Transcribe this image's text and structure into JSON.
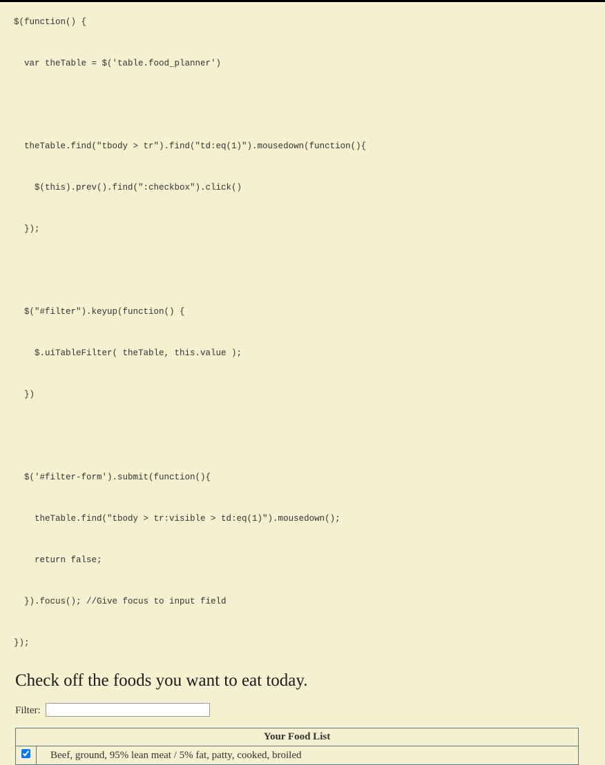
{
  "code": "$(function() {\n\n  var theTable = $('table.food_planner')\n\n\n\n  theTable.find(\"tbody > tr\").find(\"td:eq(1)\").mousedown(function(){\n\n    $(this).prev().find(\":checkbox\").click()\n\n  });\n\n\n\n  $(\"#filter\").keyup(function() {\n\n    $.uiTableFilter( theTable, this.value );\n\n  })\n\n\n\n  $('#filter-form').submit(function(){\n\n    theTable.find(\"tbody > tr:visible > td:eq(1)\").mousedown();\n\n    return false;\n\n  }).focus(); //Give focus to input field\n\n});",
  "heading": "Check off the foods you want to eat today.",
  "filter": {
    "label": "Filter:",
    "value": ""
  },
  "table": {
    "header": "Your Food List",
    "rows": [
      {
        "checked": true,
        "food": "Beef, ground, 95% lean meat / 5% fat, patty, cooked, broiled"
      }
    ]
  }
}
